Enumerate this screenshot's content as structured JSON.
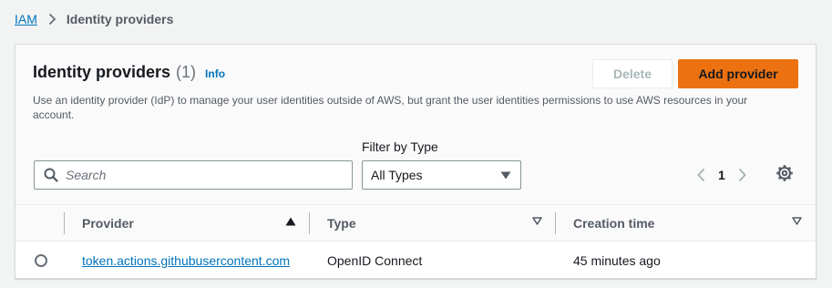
{
  "breadcrumb": {
    "root": "IAM",
    "current": "Identity providers"
  },
  "panel": {
    "title": "Identity providers",
    "count": "(1)",
    "info": "Info",
    "description": "Use an identity provider (IdP) to manage your user identities outside of AWS, but grant the user identities permissions to use AWS resources in your account.",
    "delete_label": "Delete",
    "add_label": "Add provider"
  },
  "filters": {
    "search_placeholder": "Search",
    "type_label": "Filter by Type",
    "type_value": "All Types"
  },
  "pagination": {
    "current_page": "1"
  },
  "table": {
    "columns": [
      "Provider",
      "Type",
      "Creation time"
    ],
    "rows": [
      {
        "provider": "token.actions.githubusercontent.com",
        "type": "OpenID Connect",
        "creation_time": "45 minutes ago"
      }
    ]
  },
  "colors": {
    "primary_button": "#ec7211",
    "link": "#0073bb",
    "background": "#f2f3f3"
  },
  "icons": [
    "chevron-right-icon",
    "search-icon",
    "caret-down-icon",
    "chevron-left-icon",
    "settings-icon",
    "sort-ascending-icon",
    "sort-icon"
  ]
}
